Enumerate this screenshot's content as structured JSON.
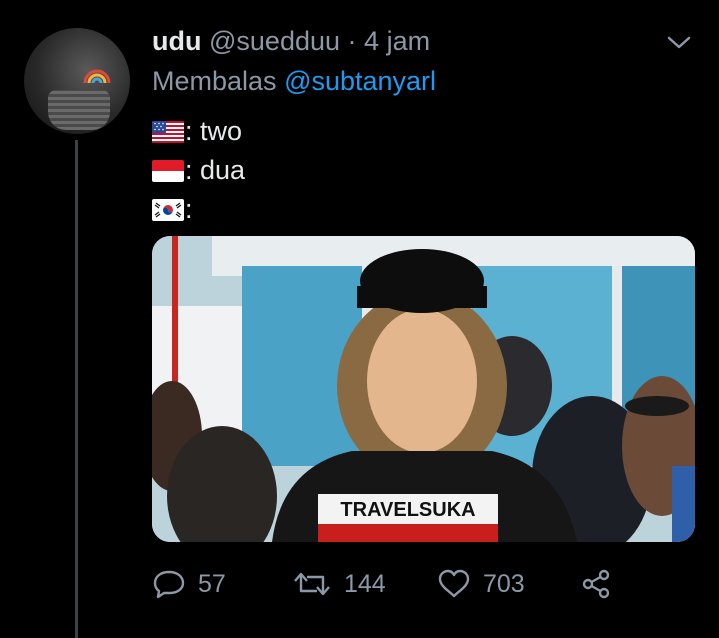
{
  "tweet": {
    "display_name": "udu",
    "handle": "@suedduu",
    "separator": "·",
    "time": "4 jam",
    "reply_prefix": "Membalas",
    "reply_to": "@subtanyarl",
    "lines": [
      {
        "flag": "us-flag",
        "text": ": two"
      },
      {
        "flag": "id-flag",
        "text": ": dua"
      },
      {
        "flag": "kr-flag",
        "text": ":"
      }
    ],
    "photo_shirt_text": "TRAVELSUKA"
  },
  "actions": {
    "replies": "57",
    "retweets": "144",
    "likes": "703"
  },
  "colors": {
    "background": "#000000",
    "link": "#1d9bf0",
    "muted": "#8b98a5"
  }
}
